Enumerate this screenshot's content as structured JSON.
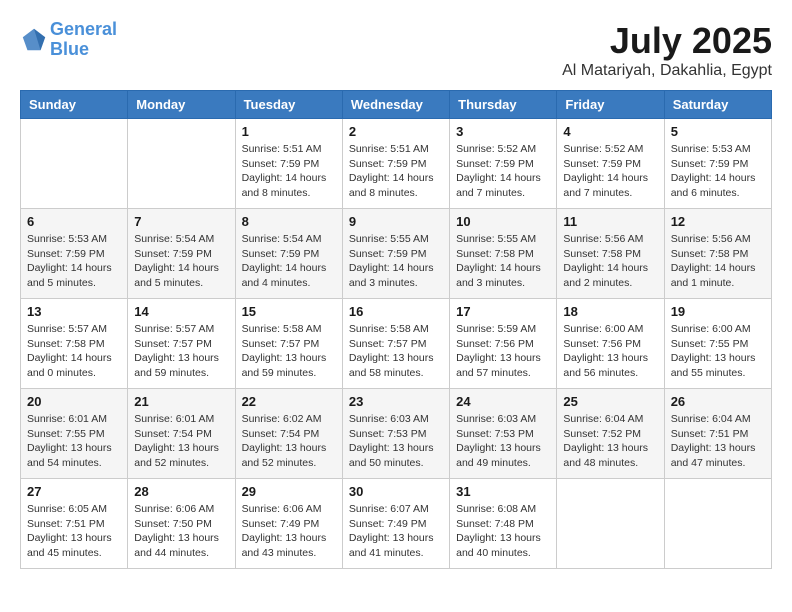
{
  "header": {
    "logo_line1": "General",
    "logo_line2": "Blue",
    "month": "July 2025",
    "location": "Al Matariyah, Dakahlia, Egypt"
  },
  "weekdays": [
    "Sunday",
    "Monday",
    "Tuesday",
    "Wednesday",
    "Thursday",
    "Friday",
    "Saturday"
  ],
  "weeks": [
    [
      {
        "day": "",
        "info": ""
      },
      {
        "day": "",
        "info": ""
      },
      {
        "day": "1",
        "info": "Sunrise: 5:51 AM\nSunset: 7:59 PM\nDaylight: 14 hours\nand 8 minutes."
      },
      {
        "day": "2",
        "info": "Sunrise: 5:51 AM\nSunset: 7:59 PM\nDaylight: 14 hours\nand 8 minutes."
      },
      {
        "day": "3",
        "info": "Sunrise: 5:52 AM\nSunset: 7:59 PM\nDaylight: 14 hours\nand 7 minutes."
      },
      {
        "day": "4",
        "info": "Sunrise: 5:52 AM\nSunset: 7:59 PM\nDaylight: 14 hours\nand 7 minutes."
      },
      {
        "day": "5",
        "info": "Sunrise: 5:53 AM\nSunset: 7:59 PM\nDaylight: 14 hours\nand 6 minutes."
      }
    ],
    [
      {
        "day": "6",
        "info": "Sunrise: 5:53 AM\nSunset: 7:59 PM\nDaylight: 14 hours\nand 5 minutes."
      },
      {
        "day": "7",
        "info": "Sunrise: 5:54 AM\nSunset: 7:59 PM\nDaylight: 14 hours\nand 5 minutes."
      },
      {
        "day": "8",
        "info": "Sunrise: 5:54 AM\nSunset: 7:59 PM\nDaylight: 14 hours\nand 4 minutes."
      },
      {
        "day": "9",
        "info": "Sunrise: 5:55 AM\nSunset: 7:59 PM\nDaylight: 14 hours\nand 3 minutes."
      },
      {
        "day": "10",
        "info": "Sunrise: 5:55 AM\nSunset: 7:58 PM\nDaylight: 14 hours\nand 3 minutes."
      },
      {
        "day": "11",
        "info": "Sunrise: 5:56 AM\nSunset: 7:58 PM\nDaylight: 14 hours\nand 2 minutes."
      },
      {
        "day": "12",
        "info": "Sunrise: 5:56 AM\nSunset: 7:58 PM\nDaylight: 14 hours\nand 1 minute."
      }
    ],
    [
      {
        "day": "13",
        "info": "Sunrise: 5:57 AM\nSunset: 7:58 PM\nDaylight: 14 hours\nand 0 minutes."
      },
      {
        "day": "14",
        "info": "Sunrise: 5:57 AM\nSunset: 7:57 PM\nDaylight: 13 hours\nand 59 minutes."
      },
      {
        "day": "15",
        "info": "Sunrise: 5:58 AM\nSunset: 7:57 PM\nDaylight: 13 hours\nand 59 minutes."
      },
      {
        "day": "16",
        "info": "Sunrise: 5:58 AM\nSunset: 7:57 PM\nDaylight: 13 hours\nand 58 minutes."
      },
      {
        "day": "17",
        "info": "Sunrise: 5:59 AM\nSunset: 7:56 PM\nDaylight: 13 hours\nand 57 minutes."
      },
      {
        "day": "18",
        "info": "Sunrise: 6:00 AM\nSunset: 7:56 PM\nDaylight: 13 hours\nand 56 minutes."
      },
      {
        "day": "19",
        "info": "Sunrise: 6:00 AM\nSunset: 7:55 PM\nDaylight: 13 hours\nand 55 minutes."
      }
    ],
    [
      {
        "day": "20",
        "info": "Sunrise: 6:01 AM\nSunset: 7:55 PM\nDaylight: 13 hours\nand 54 minutes."
      },
      {
        "day": "21",
        "info": "Sunrise: 6:01 AM\nSunset: 7:54 PM\nDaylight: 13 hours\nand 52 minutes."
      },
      {
        "day": "22",
        "info": "Sunrise: 6:02 AM\nSunset: 7:54 PM\nDaylight: 13 hours\nand 52 minutes."
      },
      {
        "day": "23",
        "info": "Sunrise: 6:03 AM\nSunset: 7:53 PM\nDaylight: 13 hours\nand 50 minutes."
      },
      {
        "day": "24",
        "info": "Sunrise: 6:03 AM\nSunset: 7:53 PM\nDaylight: 13 hours\nand 49 minutes."
      },
      {
        "day": "25",
        "info": "Sunrise: 6:04 AM\nSunset: 7:52 PM\nDaylight: 13 hours\nand 48 minutes."
      },
      {
        "day": "26",
        "info": "Sunrise: 6:04 AM\nSunset: 7:51 PM\nDaylight: 13 hours\nand 47 minutes."
      }
    ],
    [
      {
        "day": "27",
        "info": "Sunrise: 6:05 AM\nSunset: 7:51 PM\nDaylight: 13 hours\nand 45 minutes."
      },
      {
        "day": "28",
        "info": "Sunrise: 6:06 AM\nSunset: 7:50 PM\nDaylight: 13 hours\nand 44 minutes."
      },
      {
        "day": "29",
        "info": "Sunrise: 6:06 AM\nSunset: 7:49 PM\nDaylight: 13 hours\nand 43 minutes."
      },
      {
        "day": "30",
        "info": "Sunrise: 6:07 AM\nSunset: 7:49 PM\nDaylight: 13 hours\nand 41 minutes."
      },
      {
        "day": "31",
        "info": "Sunrise: 6:08 AM\nSunset: 7:48 PM\nDaylight: 13 hours\nand 40 minutes."
      },
      {
        "day": "",
        "info": ""
      },
      {
        "day": "",
        "info": ""
      }
    ]
  ]
}
